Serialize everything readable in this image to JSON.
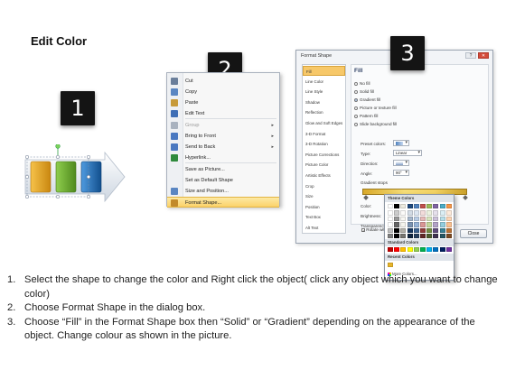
{
  "heading": "Edit Color",
  "badges": [
    "1",
    "2",
    "3"
  ],
  "context_menu": {
    "items": [
      {
        "label": "Cut",
        "icon": "scissors-icon",
        "color": "#6b7f9b",
        "enabled": true,
        "submenu": false
      },
      {
        "label": "Copy",
        "icon": "copy-icon",
        "color": "#5a86c2",
        "enabled": true,
        "submenu": false
      },
      {
        "label": "Paste",
        "icon": "paste-icon",
        "color": "#c79a3a",
        "enabled": true,
        "submenu": false
      },
      {
        "label": "Edit Text",
        "icon": "edit-text-icon",
        "color": "#3f6eb5",
        "enabled": true,
        "submenu": false
      },
      {
        "label": "Group",
        "icon": "group-icon",
        "color": "#a9b2bf",
        "enabled": false,
        "submenu": true
      },
      {
        "label": "Bring to Front",
        "icon": "bring-front-icon",
        "color": "#4a78c0",
        "enabled": true,
        "submenu": true
      },
      {
        "label": "Send to Back",
        "icon": "send-back-icon",
        "color": "#4a78c0",
        "enabled": true,
        "submenu": true
      },
      {
        "label": "Hyperlink...",
        "icon": "hyperlink-icon",
        "color": "#2f8a3c",
        "enabled": true,
        "submenu": false
      },
      {
        "label": "Save as Picture...",
        "icon": "",
        "color": "",
        "enabled": true,
        "submenu": false
      },
      {
        "label": "Set as Default Shape",
        "icon": "",
        "color": "",
        "enabled": true,
        "submenu": false
      },
      {
        "label": "Size and Position...",
        "icon": "size-position-icon",
        "color": "#5a86c2",
        "enabled": true,
        "submenu": false
      },
      {
        "label": "Format Shape...",
        "icon": "format-shape-icon",
        "color": "#c28a2a",
        "enabled": true,
        "submenu": false,
        "highlighted": true
      }
    ]
  },
  "dialog": {
    "title": "Format Shape",
    "close_label": "Close",
    "categories": [
      "Fill",
      "Line Color",
      "Line Style",
      "Shadow",
      "Reflection",
      "Glow and Soft Edges",
      "3-D Format",
      "3-D Rotation",
      "Picture Corrections",
      "Picture Color",
      "Artistic Effects",
      "Crop",
      "Size",
      "Position",
      "Text Box",
      "Alt Text"
    ],
    "selected_category": "Fill",
    "fill": {
      "heading": "Fill",
      "options": [
        {
          "label": "No fill",
          "selected": false
        },
        {
          "label": "Solid fill",
          "selected": false
        },
        {
          "label": "Gradient fill",
          "selected": true
        },
        {
          "label": "Picture or texture fill",
          "selected": false
        },
        {
          "label": "Pattern fill",
          "selected": false
        },
        {
          "label": "Slide background fill",
          "selected": false
        }
      ],
      "preset_colors_label": "Preset colors:",
      "type_label": "Type:",
      "type_value": "Linear",
      "direction_label": "Direction:",
      "angle_label": "Angle:",
      "angle_value": "90°",
      "gradient_stops_label": "Gradient stops",
      "color_label": "Color:",
      "position_label": "Position:",
      "position_value": "0%",
      "brightness_label": "Brightness:",
      "transparency_label": "Transparency:",
      "rotate_label": "Rotate with shape"
    },
    "color_popup": {
      "theme_label": "Theme Colors",
      "standard_label": "Standard Colors",
      "recent_label": "Recent Colors",
      "more_label": "More Colors...",
      "theme_top": [
        "#ffffff",
        "#000000",
        "#eeece1",
        "#1f497d",
        "#4f81bd",
        "#c0504d",
        "#9bbb59",
        "#8064a2",
        "#4bacc6",
        "#f79646"
      ],
      "standard": [
        "#c00000",
        "#ff0000",
        "#ffc000",
        "#ffff00",
        "#92d050",
        "#00b050",
        "#00b0f0",
        "#0070c0",
        "#002060",
        "#7030a0"
      ],
      "recent": [
        "#e8b52a"
      ]
    }
  },
  "shape_colors": [
    "#e6a21c",
    "#6aa92c",
    "#1e6ab3",
    "#dfe6ef"
  ],
  "steps": [
    {
      "num": "1.",
      "text": "Select the shape to change the color and Right click the object( click any object which you want to change color)"
    },
    {
      "num": "2.",
      "text": "Choose Format Shape in the dialog box."
    },
    {
      "num": "3.",
      "text": "Choose “Fill” in the Format Shape box then “Solid” or “Gradient” depending on the appearance of the object. Change colour as shown in the picture."
    }
  ]
}
